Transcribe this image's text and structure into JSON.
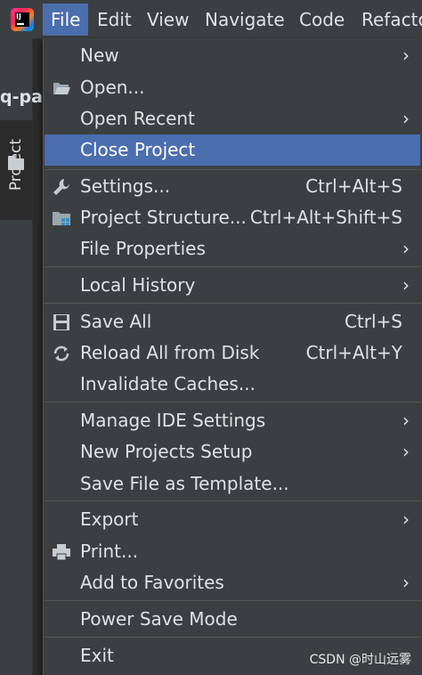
{
  "menubar": {
    "items": [
      {
        "label": "File",
        "active": true
      },
      {
        "label": "Edit"
      },
      {
        "label": "View"
      },
      {
        "label": "Navigate"
      },
      {
        "label": "Code"
      },
      {
        "label": "Refacto"
      }
    ]
  },
  "project": {
    "name": "q-par",
    "tool_window_label": "Project"
  },
  "file_menu": {
    "items": [
      {
        "label": "New",
        "submenu": true
      },
      {
        "label": "Open...",
        "icon": "folder-open-icon"
      },
      {
        "label": "Open Recent",
        "submenu": true
      },
      {
        "label": "Close Project",
        "selected": true
      },
      {
        "label": "Settings...",
        "shortcut": "Ctrl+Alt+S",
        "icon": "wrench-icon"
      },
      {
        "label": "Project Structure...",
        "shortcut": "Ctrl+Alt+Shift+S",
        "icon": "project-structure-icon"
      },
      {
        "label": "File Properties",
        "submenu": true
      },
      {
        "label": "Local History",
        "submenu": true
      },
      {
        "label": "Save All",
        "shortcut": "Ctrl+S",
        "icon": "save-icon"
      },
      {
        "label": "Reload All from Disk",
        "shortcut": "Ctrl+Alt+Y",
        "icon": "reload-icon"
      },
      {
        "label": "Invalidate Caches..."
      },
      {
        "label": "Manage IDE Settings",
        "submenu": true
      },
      {
        "label": "New Projects Setup",
        "submenu": true
      },
      {
        "label": "Save File as Template..."
      },
      {
        "label": "Export",
        "submenu": true
      },
      {
        "label": "Print...",
        "icon": "printer-icon"
      },
      {
        "label": "Add to Favorites",
        "submenu": true
      },
      {
        "label": "Power Save Mode"
      },
      {
        "label": "Exit"
      }
    ],
    "submenu_arrow": "›"
  },
  "watermark": "CSDN @时山远雾",
  "colors": {
    "menubar": "#3c3f41",
    "selection": "#4b6eaf",
    "text": "#dfe1e5",
    "separator": "#555555"
  }
}
